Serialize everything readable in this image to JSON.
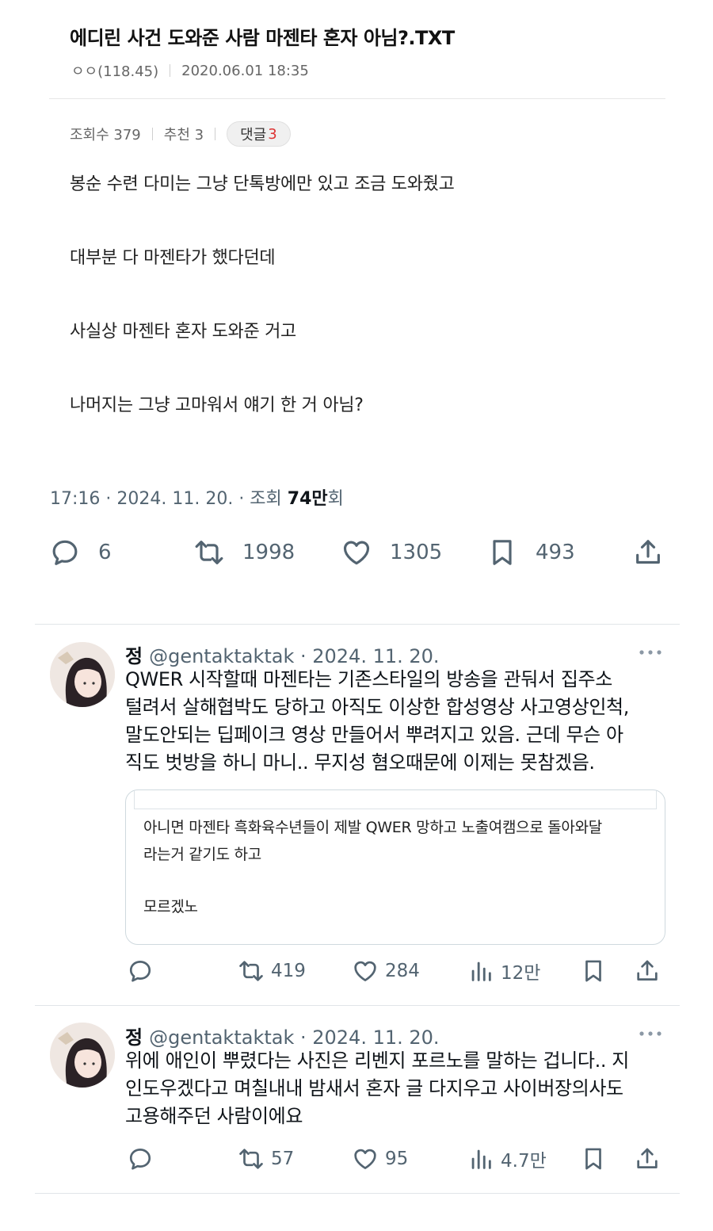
{
  "post": {
    "title": "에디린 사건 도와준 사람 마젠타 혼자 아님?.TXT",
    "author": "ㅇㅇ(118.45)",
    "datetime": "2020.06.01 18:35",
    "views_label": "조회수 379",
    "recommend_label": "추천 3",
    "comment_label": "댓글",
    "comment_count": "3",
    "lines": [
      "봉순 수련 다미는 그냥 단톡방에만 있고 조금 도와줬고",
      "대부분 다 마젠타가 했다던데",
      "사실상 마젠타 혼자 도와준 거고",
      "나머지는 그냥 고마워서 얘기 한 거 아님?"
    ]
  },
  "tweet": {
    "time_prefix": "17:16 · 2024. 11. 20. · 조회 ",
    "views_bold": "74만",
    "views_suffix": "회",
    "replies": "6",
    "retweets": "1998",
    "likes": "1305",
    "bookmarks": "493"
  },
  "replies": [
    {
      "name": "정",
      "handle_date": "@gentaktaktak · 2024. 11. 20.",
      "lines": [
        "QWER 시작할때 마젠타는 기존스타일의 방송을 관둬서 집주소",
        "털려서 살해협박도 당하고 아직도 이상한 합성영상 사고영상인척,",
        "말도안되는 딥페이크 영상 만들어서 뿌려지고 있음. 근데 무슨 아",
        "직도 벗방을 하니 마니.. 무지성 혐오때문에 이제는 못참겠음."
      ],
      "quote_lines": [
        "아니면 마젠타 흑화육수년들이 제발 QWER 망하고 노출여캠으로 돌아와달",
        "라는거 같기도 하고",
        "모르겠노"
      ],
      "retweets": "419",
      "likes": "284",
      "views": "12만"
    },
    {
      "name": "정",
      "handle_date": "@gentaktaktak · 2024. 11. 20.",
      "lines": [
        "위에 애인이 뿌렸다는 사진은 리벤지 포르노를 말하는 겁니다.. 지",
        "인도우겠다고 며칠내내 밤새서 혼자 글 다지우고 사이버장의사도",
        "고용해주던 사람이에요"
      ],
      "retweets": "57",
      "likes": "95",
      "views": "4.7만"
    }
  ],
  "icons": [
    "reply-icon",
    "retweet-icon",
    "like-icon",
    "bookmark-icon",
    "share-icon",
    "views-icon",
    "more-icon"
  ],
  "colors": {
    "muted": "#536471",
    "text": "#0f1419",
    "comment_count": "#dd3333",
    "border": "#cfd9de"
  }
}
